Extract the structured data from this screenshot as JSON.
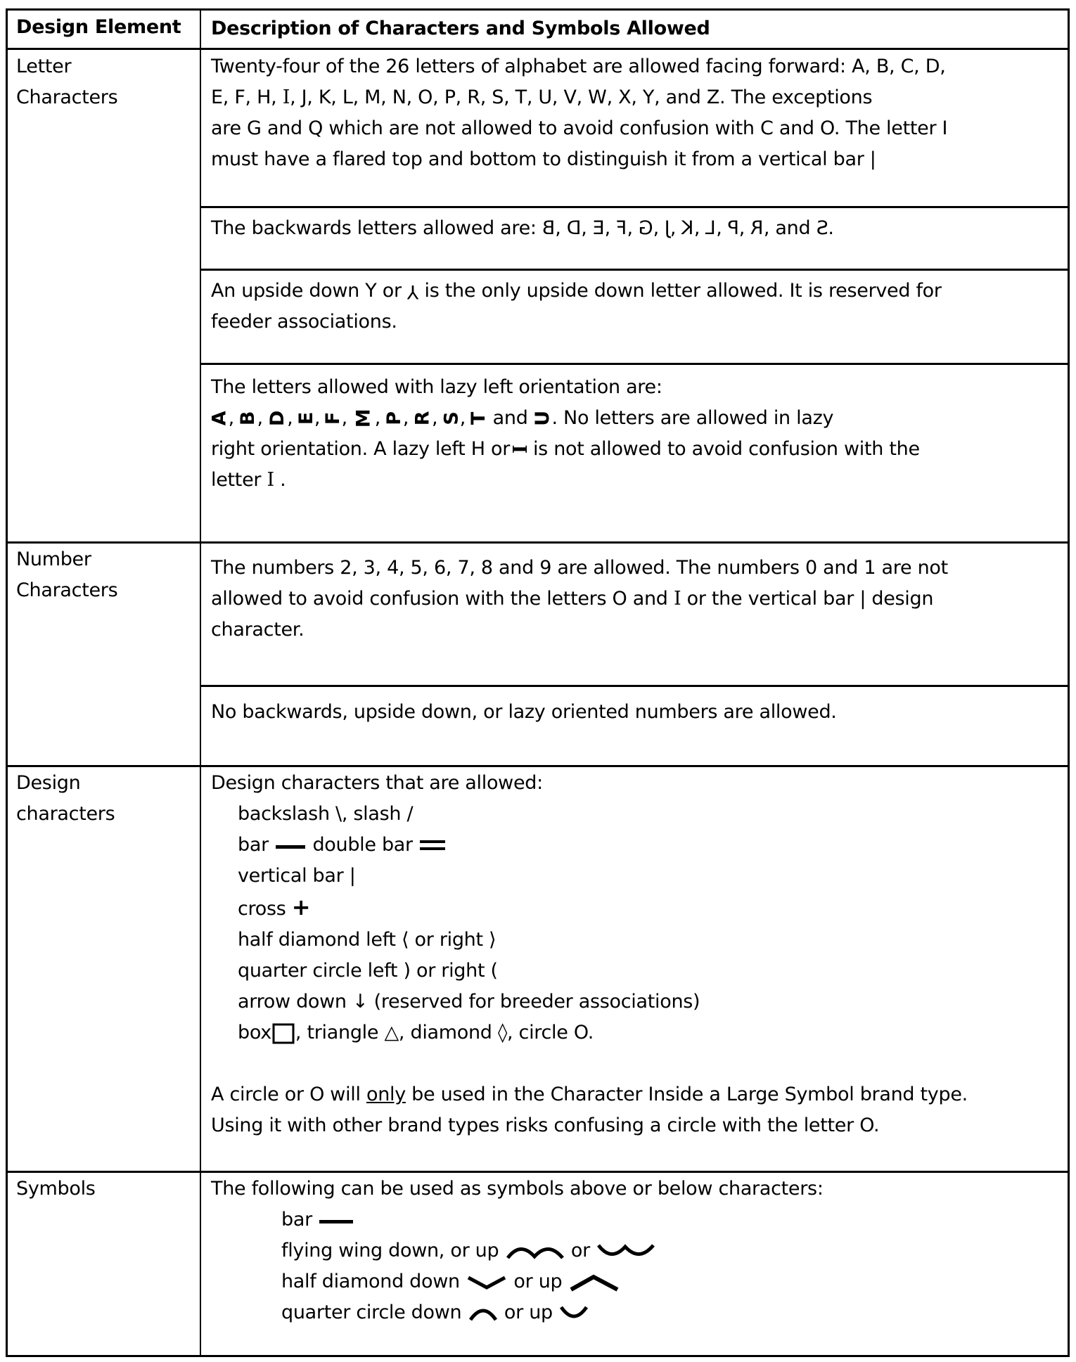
{
  "header": {
    "col1": "Design Element",
    "col2": "Description of Characters and Symbols Allowed"
  },
  "letters": {
    "label_line1": "Letter",
    "label_line2": "Characters",
    "forward": {
      "line1": "Twenty-four of the 26 letters of alphabet are allowed facing forward: A, B, C, D,",
      "line2_a": "E, F, H, ",
      "line2_I": "I",
      "line2_b": ", J, K, L, M, N, O, P, R, S, T, U, V, W, X, Y, and Z. The exceptions",
      "line3": "are G and Q which are not allowed to avoid confusion with C and O.  The letter I",
      "line4": "must have a flared top and bottom to distinguish it from a vertical bar",
      "vbar": "|"
    },
    "backwards": {
      "intro": "The backwards letters allowed are: ",
      "letters": [
        "B",
        "D",
        "E",
        "F",
        "G",
        "J",
        "K",
        "L",
        "P",
        "R"
      ],
      "and": ", and ",
      "last": "S",
      "end": "."
    },
    "upside_down": {
      "line1_a": "An upside down Y or ",
      "glyph": "Y",
      "line1_b": " is the only upside down letter allowed. It is reserved for",
      "line2": "feeder associations."
    },
    "lazy_left": {
      "line1": "The letters allowed with lazy left orientation are:",
      "letters": [
        "A",
        "B",
        "D",
        "E",
        "F",
        "M",
        "P",
        "R",
        "S",
        "T"
      ],
      "and": "  and ",
      "last": "U",
      "line2_tail": ". No letters are allowed in lazy",
      "line3_a": "right orientation. A lazy left H or ",
      "line3_glyph": "I",
      "line3_b": "  is not allowed to avoid confusion with the",
      "line4_a": "letter ",
      "line4_glyph": "I",
      "line4_b": " ."
    }
  },
  "numbers": {
    "label_line1": "Number",
    "label_line2": "Characters",
    "allowed": {
      "line1": "The numbers 2, 3, 4, 5, 6, 7, 8 and 9 are allowed. The numbers 0 and 1 are not",
      "line2_a": "allowed to avoid confusion with the letters O and ",
      "line2_I": "I",
      "line2_b": " or the vertical bar ",
      "line2_vbar": "|",
      "line2_c": " design",
      "line3": "character."
    },
    "orientation": "No backwards, upside down, or lazy oriented numbers are allowed."
  },
  "design": {
    "label_line1": "Design",
    "label_line2": "characters",
    "intro": "Design characters that are allowed:",
    "items": [
      {
        "text": "backslash \\, slash /"
      },
      {
        "text_a": "bar ",
        "text_b": " double bar "
      },
      {
        "text": "vertical bar ",
        "glyph": "|"
      },
      {
        "text": "cross ",
        "glyph": "+"
      },
      {
        "text_a": "half diamond left ",
        "glyph_a": "⟨",
        "text_b": " or right ",
        "glyph_b": "⟩"
      },
      {
        "text_a": "quarter circle left ",
        "glyph_a": ")",
        "text_b": " or right ",
        "glyph_b": "("
      },
      {
        "text_a": "arrow down ",
        "glyph": "↓",
        "text_b": "  (reserved for breeder associations)"
      },
      {
        "text_a": "box",
        "text_b": ",  triangle ",
        "glyph_tri": "△",
        "text_c": ", diamond ",
        "glyph_dia": "◊",
        "text_d": ", circle ",
        "glyph_circ": "O",
        "text_e": "."
      }
    ],
    "note_line1_a": "A circle or ",
    "note_line1_O": "O",
    "note_line1_b": " will ",
    "note_line1_u": "only",
    "note_line1_c": " be used in the Character Inside a Large Symbol brand type.",
    "note_line2": "Using it with other brand types risks confusing a circle with the letter O."
  },
  "symbols": {
    "label": "Symbols",
    "intro": "The following can be used as symbols above or below characters:",
    "bar": "bar ",
    "flying_wing_a": "flying wing down, or up ",
    "flying_wing_or": " or ",
    "half_diamond_a": "half diamond down ",
    "half_diamond_or": " or up ",
    "quarter_circle_a": "quarter circle down ",
    "quarter_circle_or": " or up "
  }
}
